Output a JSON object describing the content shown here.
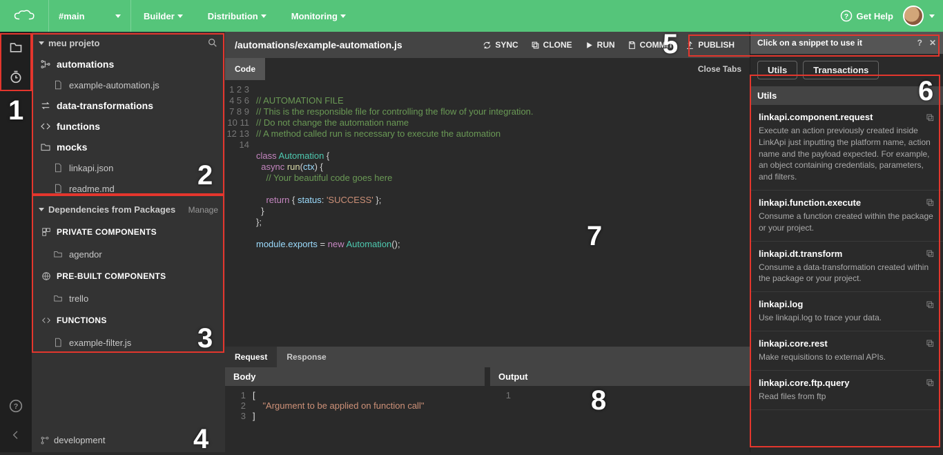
{
  "topbar": {
    "branch": "#main",
    "menu": [
      "Builder",
      "Distribution",
      "Monitoring"
    ],
    "getHelp": "Get Help"
  },
  "sidebar": {
    "projectTitle": "meu projeto",
    "tree": {
      "automations": "automations",
      "automations_file": "example-automation.js",
      "dataTransformations": "data-transformations",
      "functions": "functions",
      "mocks": "mocks",
      "linkapiJson": "linkapi.json",
      "readme": "readme.md"
    },
    "deps": {
      "title": "Dependencies from Packages",
      "manage": "Manage",
      "private": "PRIVATE COMPONENTS",
      "private_items": [
        "agendor"
      ],
      "prebuilt": "PRE-BUILT COMPONENTS",
      "prebuilt_items": [
        "trello"
      ],
      "functions": "FUNCTIONS",
      "functions_items": [
        "example-filter.js"
      ]
    },
    "footer": "development"
  },
  "editor": {
    "path": "/automations/example-automation.js",
    "actions": {
      "sync": "SYNC",
      "clone": "CLONE",
      "run": "RUN",
      "commit": "COMMIT",
      "publish": "PUBLISH"
    },
    "tab": "Code",
    "closeTabs": "Close Tabs",
    "lineCount": 14,
    "comments": {
      "l1": "// AUTOMATION FILE",
      "l2": "// This is the responsible file for controlling the flow of your integration.",
      "l3": "// Do not change the automation name",
      "l4": "// A method called run is necessary to execute the automation",
      "l8": "// Your beautiful code goes here"
    },
    "tokens": {
      "class": "class",
      "Automation": "Automation",
      "async": "async",
      "run": "run",
      "ctx": "ctx",
      "return": "return",
      "status": "status",
      "success": "'SUCCESS'",
      "module": "module",
      "exports": "exports",
      "new": "new",
      "AutomationCtor": "Automation"
    }
  },
  "bottom": {
    "tabs": {
      "request": "Request",
      "response": "Response"
    },
    "body": "Body",
    "bodyCode": {
      "l1": "[",
      "l2": "    \"Argument to be applied on function call\"",
      "l3": "]"
    },
    "output": "Output"
  },
  "right": {
    "hint": "Click on a snippet to use it",
    "helpIcon": "?",
    "tabs": {
      "utils": "Utils",
      "transactions": "Transactions"
    },
    "section": "Utils",
    "snippets": [
      {
        "title": "linkapi.component.request",
        "desc": "Execute an action previously created inside LinkApi just inputting the platform name, action name and the payload expected. For example, an object containing credentials, parameters, and filters."
      },
      {
        "title": "linkapi.function.execute",
        "desc": "Consume a function created within the package or your project."
      },
      {
        "title": "linkapi.dt.transform",
        "desc": "Consume a data-transformation created within the package or your project."
      },
      {
        "title": "linkapi.log",
        "desc": "Use linkapi.log to trace your data."
      },
      {
        "title": "linkapi.core.rest",
        "desc": "Make requisitions to external APIs."
      },
      {
        "title": "linkapi.core.ftp.query",
        "desc": "Read files from ftp"
      }
    ]
  },
  "annotations": {
    "1": "1",
    "2": "2",
    "3": "3",
    "4": "4",
    "5": "5",
    "6": "6",
    "7": "7",
    "8": "8"
  }
}
